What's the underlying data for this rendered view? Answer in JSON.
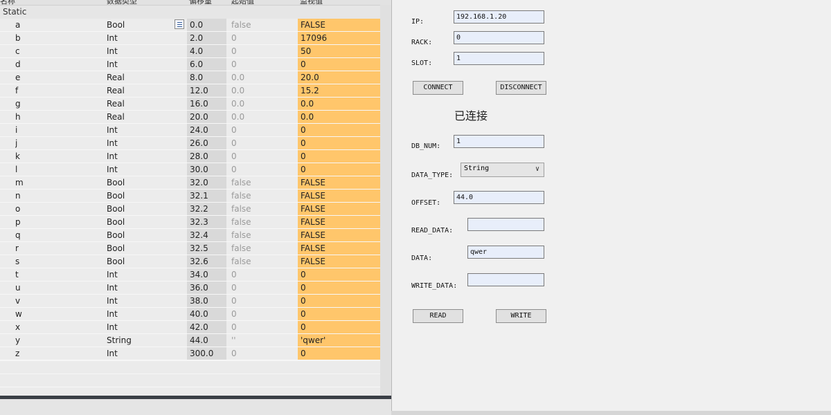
{
  "table": {
    "column_headers": [
      "名称",
      "数据类型",
      "偏移量",
      "起始值",
      "监视值"
    ],
    "section_label": "Static",
    "rows": [
      {
        "name": "a",
        "type": "Bool",
        "offset": "0.0",
        "start": "false",
        "monitor": "FALSE"
      },
      {
        "name": "b",
        "type": "Int",
        "offset": "2.0",
        "start": "0",
        "monitor": "17096"
      },
      {
        "name": "c",
        "type": "Int",
        "offset": "4.0",
        "start": "0",
        "monitor": "50"
      },
      {
        "name": "d",
        "type": "Int",
        "offset": "6.0",
        "start": "0",
        "monitor": "0"
      },
      {
        "name": "e",
        "type": "Real",
        "offset": "8.0",
        "start": "0.0",
        "monitor": "20.0"
      },
      {
        "name": "f",
        "type": "Real",
        "offset": "12.0",
        "start": "0.0",
        "monitor": "15.2"
      },
      {
        "name": "g",
        "type": "Real",
        "offset": "16.0",
        "start": "0.0",
        "monitor": "0.0"
      },
      {
        "name": "h",
        "type": "Real",
        "offset": "20.0",
        "start": "0.0",
        "monitor": "0.0"
      },
      {
        "name": "i",
        "type": "Int",
        "offset": "24.0",
        "start": "0",
        "monitor": "0"
      },
      {
        "name": "j",
        "type": "Int",
        "offset": "26.0",
        "start": "0",
        "monitor": "0"
      },
      {
        "name": "k",
        "type": "Int",
        "offset": "28.0",
        "start": "0",
        "monitor": "0"
      },
      {
        "name": "l",
        "type": "Int",
        "offset": "30.0",
        "start": "0",
        "monitor": "0"
      },
      {
        "name": "m",
        "type": "Bool",
        "offset": "32.0",
        "start": "false",
        "monitor": "FALSE"
      },
      {
        "name": "n",
        "type": "Bool",
        "offset": "32.1",
        "start": "false",
        "monitor": "FALSE"
      },
      {
        "name": "o",
        "type": "Bool",
        "offset": "32.2",
        "start": "false",
        "monitor": "FALSE"
      },
      {
        "name": "p",
        "type": "Bool",
        "offset": "32.3",
        "start": "false",
        "monitor": "FALSE"
      },
      {
        "name": "q",
        "type": "Bool",
        "offset": "32.4",
        "start": "false",
        "monitor": "FALSE"
      },
      {
        "name": "r",
        "type": "Bool",
        "offset": "32.5",
        "start": "false",
        "monitor": "FALSE"
      },
      {
        "name": "s",
        "type": "Bool",
        "offset": "32.6",
        "start": "false",
        "monitor": "FALSE"
      },
      {
        "name": "t",
        "type": "Int",
        "offset": "34.0",
        "start": "0",
        "monitor": "0"
      },
      {
        "name": "u",
        "type": "Int",
        "offset": "36.0",
        "start": "0",
        "monitor": "0"
      },
      {
        "name": "v",
        "type": "Int",
        "offset": "38.0",
        "start": "0",
        "monitor": "0"
      },
      {
        "name": "w",
        "type": "Int",
        "offset": "40.0",
        "start": "0",
        "monitor": "0"
      },
      {
        "name": "x",
        "type": "Int",
        "offset": "42.0",
        "start": "0",
        "monitor": "0"
      },
      {
        "name": "y",
        "type": "String",
        "offset": "44.0",
        "start": "''",
        "monitor": "'qwer'"
      },
      {
        "name": "z",
        "type": "Int",
        "offset": "300.0",
        "start": "0",
        "monitor": "0"
      }
    ],
    "monitor_color": "#ffc66b"
  },
  "form": {
    "ip_label": "IP:",
    "ip_value": "192.168.1.20",
    "rack_label": "RACK:",
    "rack_value": "0",
    "slot_label": "SLOT:",
    "slot_value": "1",
    "connect_label": "CONNECT",
    "disconnect_label": "DISCONNECT",
    "status_text": "已连接",
    "db_num_label": "DB_NUM:",
    "db_num_value": "1",
    "data_type_label": "DATA_TYPE:",
    "data_type_value": "String",
    "offset_label": "OFFSET:",
    "offset_value": "44.0",
    "read_data_label": "READ_DATA:",
    "read_data_value": "",
    "data_label": "DATA:",
    "data_value": "qwer",
    "write_data_label": "WRITE_DATA:",
    "write_data_value": "",
    "read_label": "READ",
    "write_label": "WRITE"
  }
}
